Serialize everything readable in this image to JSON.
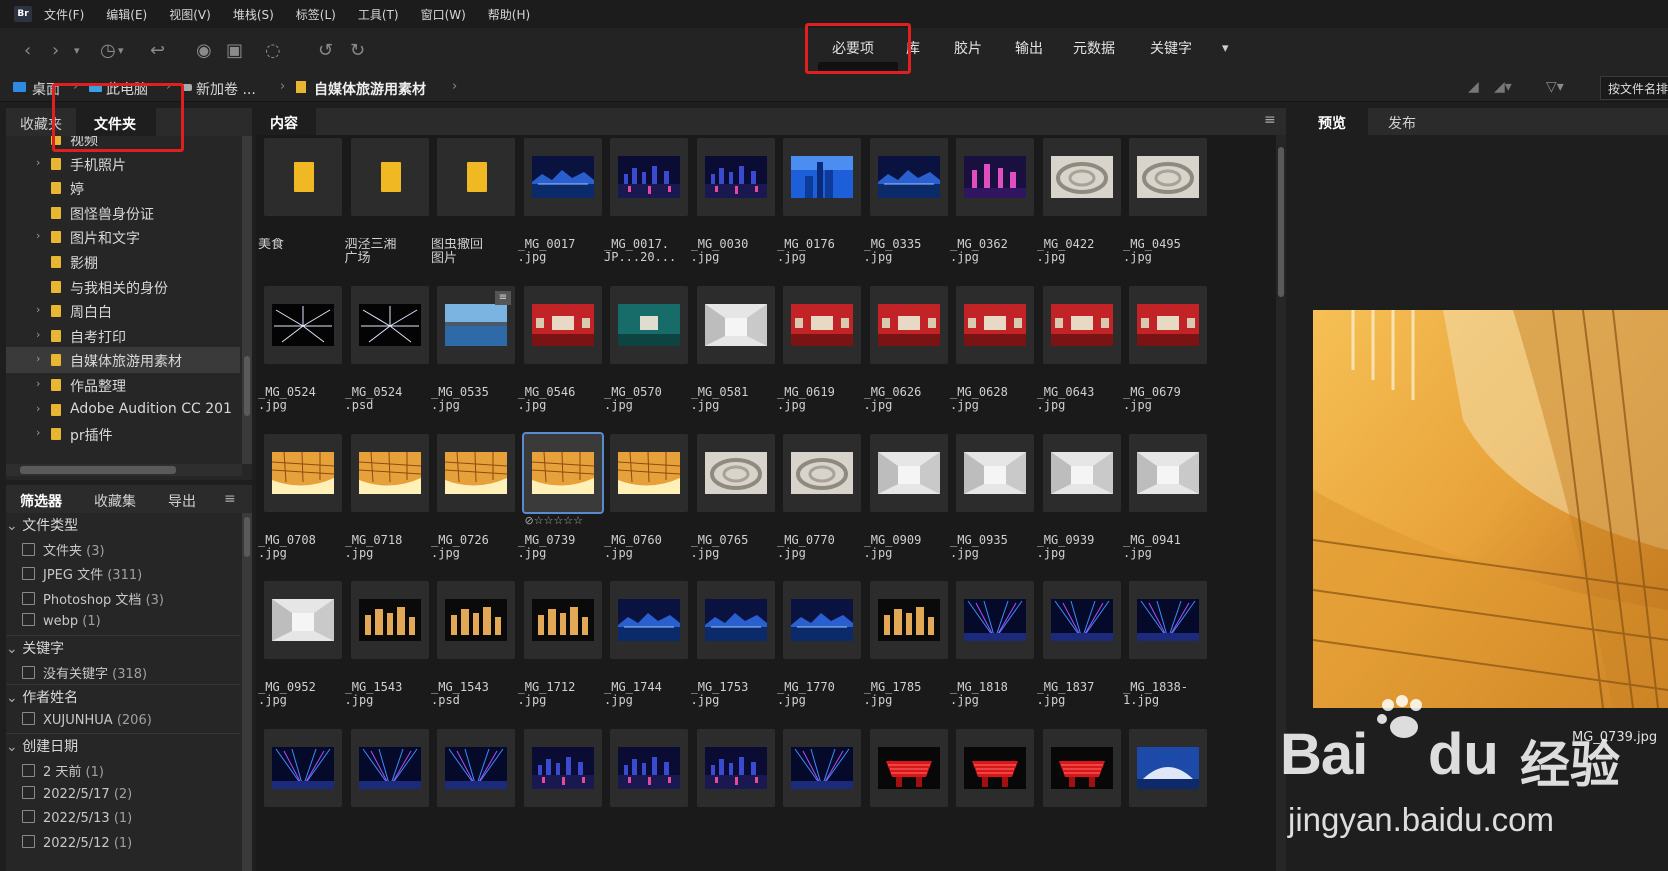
{
  "menubar": {
    "logo": "Br",
    "items": [
      "文件(F)",
      "编辑(E)",
      "视图(V)",
      "堆栈(S)",
      "标签(L)",
      "工具(T)",
      "窗口(W)",
      "帮助(H)"
    ]
  },
  "workspaces": {
    "active": "必要项",
    "items": [
      "库",
      "胶片",
      "输出",
      "元数据",
      "关键字"
    ]
  },
  "breadcrumb": [
    "桌面",
    "此电脑",
    "新加卷 ...",
    "自媒体旅游用素材"
  ],
  "sort_label": "按文件名排",
  "left_tabs": [
    "收藏夹",
    "文件夹"
  ],
  "tree": [
    {
      "label": "视频",
      "expandable": false
    },
    {
      "label": "手机照片",
      "expandable": true
    },
    {
      "label": "婷",
      "expandable": false
    },
    {
      "label": "图怪兽身份证",
      "expandable": false
    },
    {
      "label": "图片和文字",
      "expandable": true
    },
    {
      "label": "影棚",
      "expandable": false
    },
    {
      "label": "与我相关的身份",
      "expandable": false
    },
    {
      "label": "周白白",
      "expandable": true
    },
    {
      "label": "自考打印",
      "expandable": true
    },
    {
      "label": "自媒体旅游用素材",
      "expandable": true,
      "selected": true
    },
    {
      "label": "作品整理",
      "expandable": true
    },
    {
      "label": "Adobe Audition CC 201",
      "expandable": true
    },
    {
      "label": "pr插件",
      "expandable": true
    }
  ],
  "filter_tabs": [
    "筛选器",
    "收藏集",
    "导出"
  ],
  "filters": [
    {
      "head": "文件类型",
      "rows": [
        {
          "label": "文件夹",
          "count": "(3)"
        },
        {
          "label": "JPEG 文件",
          "count": "(311)"
        },
        {
          "label": "Photoshop 文档",
          "count": "(3)"
        },
        {
          "label": "webp",
          "count": "(1)"
        }
      ]
    },
    {
      "head": "关键字",
      "rows": [
        {
          "label": "没有关键字",
          "count": "(318)"
        }
      ]
    },
    {
      "head": "作者姓名",
      "rows": [
        {
          "label": "XUJUNHUA",
          "count": "(206)"
        }
      ]
    },
    {
      "head": "创建日期",
      "rows": [
        {
          "label": "2 天前",
          "count": "(1)"
        },
        {
          "label": "2022/5/17",
          "count": "(2)"
        },
        {
          "label": "2022/5/13",
          "count": "(1)"
        },
        {
          "label": "2022/5/12",
          "count": "(1)"
        }
      ]
    }
  ],
  "content_tab": "内容",
  "right_tabs": [
    "预览",
    "发布"
  ],
  "preview_filename": "MG_0739.jpg",
  "selected_rating": "☆☆☆☆☆",
  "thumbnails": [
    [
      {
        "name": "美食",
        "kind": "folder"
      },
      {
        "name": "泗泾三湘\n广场",
        "kind": "folder"
      },
      {
        "name": "图虫撤回\n图片",
        "kind": "folder"
      },
      {
        "name": "_MG_0017\n.jpg",
        "kind": "night-blue"
      },
      {
        "name": "_MG_0017.\nJP...20...",
        "kind": "night-city"
      },
      {
        "name": "_MG_0030\n.jpg",
        "kind": "night-city"
      },
      {
        "name": "_MG_0176\n.jpg",
        "kind": "tower-blue"
      },
      {
        "name": "_MG_0335\n.jpg",
        "kind": "night-blue"
      },
      {
        "name": "_MG_0362\n.jpg",
        "kind": "night-pink"
      },
      {
        "name": "_MG_0422\n.jpg",
        "kind": "white-spiral"
      },
      {
        "name": "_MG_0495\n.jpg",
        "kind": "white-spiral"
      }
    ],
    [
      {
        "name": "_MG_0524\n.jpg",
        "kind": "light-burst"
      },
      {
        "name": "_MG_0524\n.psd",
        "kind": "light-burst"
      },
      {
        "name": "_MG_0535\n.jpg",
        "kind": "lake"
      },
      {
        "name": "_MG_0546\n.jpg",
        "kind": "red-room"
      },
      {
        "name": "_MG_0570\n.jpg",
        "kind": "teal-room"
      },
      {
        "name": "_MG_0581\n.jpg",
        "kind": "white-room"
      },
      {
        "name": "_MG_0619\n.jpg",
        "kind": "red-room"
      },
      {
        "name": "_MG_0626\n.jpg",
        "kind": "red-room"
      },
      {
        "name": "_MG_0628\n.jpg",
        "kind": "red-room"
      },
      {
        "name": "_MG_0643\n.jpg",
        "kind": "red-room"
      },
      {
        "name": "_MG_0679\n.jpg",
        "kind": "red-room"
      }
    ],
    [
      {
        "name": "_MG_0708\n.jpg",
        "kind": "gold-library"
      },
      {
        "name": "_MG_0718\n.jpg",
        "kind": "gold-library"
      },
      {
        "name": "_MG_0726\n.jpg",
        "kind": "gold-library"
      },
      {
        "name": "_MG_0739\n.jpg",
        "kind": "gold-library",
        "selected": true
      },
      {
        "name": "_MG_0760\n.jpg",
        "kind": "gold-library"
      },
      {
        "name": "_MG_0765\n.jpg",
        "kind": "white-spiral"
      },
      {
        "name": "_MG_0770\n.jpg",
        "kind": "white-spiral"
      },
      {
        "name": "_MG_0909\n.jpg",
        "kind": "white-room"
      },
      {
        "name": "_MG_0935\n.jpg",
        "kind": "white-room"
      },
      {
        "name": "_MG_0939\n.jpg",
        "kind": "white-room"
      },
      {
        "name": "_MG_0941\n.jpg",
        "kind": "white-room"
      }
    ],
    [
      {
        "name": "_MG_0952\n.jpg",
        "kind": "white-room"
      },
      {
        "name": "_MG_1543\n.jpg",
        "kind": "night-gold"
      },
      {
        "name": "_MG_1543\n.psd",
        "kind": "night-gold"
      },
      {
        "name": "_MG_1712\n.jpg",
        "kind": "night-gold"
      },
      {
        "name": "_MG_1744\n.jpg",
        "kind": "night-blue"
      },
      {
        "name": "_MG_1753\n.jpg",
        "kind": "night-blue"
      },
      {
        "name": "_MG_1770\n.jpg",
        "kind": "night-blue"
      },
      {
        "name": "_MG_1785\n.jpg",
        "kind": "night-gold"
      },
      {
        "name": "_MG_1818\n.jpg",
        "kind": "laser"
      },
      {
        "name": "_MG_1837\n.jpg",
        "kind": "laser"
      },
      {
        "name": "_MG_1838-\n1.jpg",
        "kind": "laser"
      }
    ],
    [
      {
        "name": "",
        "kind": "laser"
      },
      {
        "name": "",
        "kind": "laser"
      },
      {
        "name": "",
        "kind": "laser"
      },
      {
        "name": "",
        "kind": "night-city"
      },
      {
        "name": "",
        "kind": "night-city"
      },
      {
        "name": "",
        "kind": "night-city"
      },
      {
        "name": "",
        "kind": "laser"
      },
      {
        "name": "",
        "kind": "red-pavilion"
      },
      {
        "name": "",
        "kind": "red-pavilion"
      },
      {
        "name": "",
        "kind": "red-pavilion"
      },
      {
        "name": "",
        "kind": "blue-dome"
      }
    ]
  ],
  "watermark": {
    "brand": "Bai",
    "brand2": "du",
    "cn": "经验",
    "url": "jingyan.baidu.com"
  },
  "colors": {
    "accent": "#e01f1f",
    "folder": "#f0b823",
    "selection": "#5a8ad0"
  }
}
